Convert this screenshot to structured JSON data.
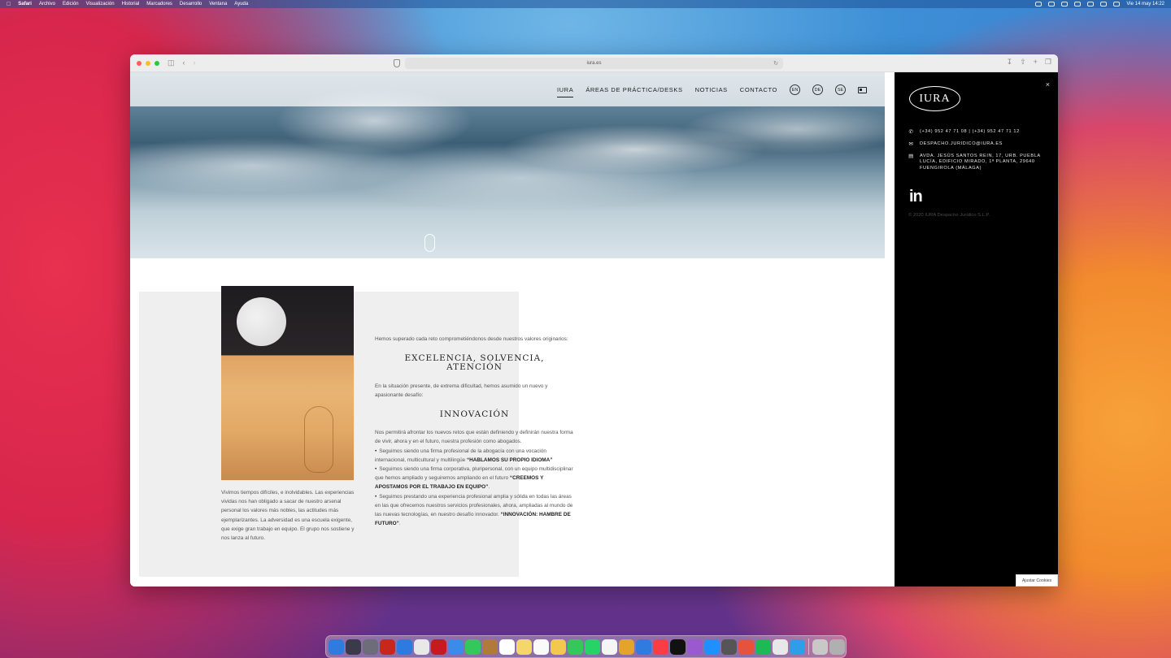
{
  "menubar": {
    "app": "Safari",
    "items": [
      "Archivo",
      "Edición",
      "Visualización",
      "Historial",
      "Marcadores",
      "Desarrollo",
      "Ventana",
      "Ayuda"
    ],
    "clock": "Vie 14 may  14:22"
  },
  "browser": {
    "url": "iura.es"
  },
  "site": {
    "nav": [
      "IURA",
      "ÁREAS DE PRÁCTICA/DESKS",
      "NOTICIAS",
      "CONTACTO"
    ],
    "languages": [
      "EN",
      "DE",
      "SE"
    ]
  },
  "content": {
    "left_text": "Vivimos tiempos difíciles, e inolvidables. Las experiencias vividas nos han obligado a sacar de nuestro arsenal personal los valores más nobles, las actitudes más ejemplarizantes. La adversidad es una escuela exigente, que exige gran trabajo en equipo. El grupo nos sostiene y nos lanza al futuro.",
    "intro": "Hemos superado cada reto comprometiéndonos desde nuestros valores originarios:",
    "heading1": "EXCELENCIA, SOLVENCIA, ATENCIÓN",
    "para2": "En la situación presente, de extrema dificultad, hemos asumido un nuevo y apasionante desafío:",
    "heading2": "INNOVACIÓN",
    "para3": "Nos permitirá afrontar los nuevos retos que están definiendo y definirán nuestra forma de vivir, ahora y en el futuro, nuestra profesión como abogados.",
    "bullet1": "Seguimos siendo una firma profesional de la abogacía con una vocación internacional, multicultural y multilingüe ",
    "bullet1_strong": "“HABLAMOS SU PROPIO IDIOMA”",
    "bullet2": "Seguimos siendo una firma corporativa, pluripersonal, con un equipo multidisciplinar que hemos ampliado y seguiremos ampliando en el futuro ",
    "bullet2_strong": "“CREEMOS Y APOSTAMOS POR EL TRABAJO EN EQUIPO”",
    "bullet2_end": ".",
    "bullet3": "Seguimos prestando una experiencia profesional amplia y sólida en todas las áreas en las que ofrecemos nuestros servicios profesionales, ahora, ampliadas al mundo de las nuevas tecnologías, en nuestro desafío innovador. ",
    "bullet3_strong": "“INNOVACIÓN: HAMBRE DE FUTURO”",
    "bullet3_end": "."
  },
  "sidebar": {
    "logo": "IURA",
    "close_icon": "×",
    "phone": "(+34) 952 47 71 08 | (+34) 952 47 71 12",
    "email": "DESPACHO.JURIDICO@IURA.ES",
    "address": "AVDA. JESÚS SANTOS REIN, 17, URB. PUEBLA LUCÍA, EDIFICIO MIRADO, 1ª PLANTA, 29640 FUENGIROLA (MÁLAGA)",
    "linkedin": "in",
    "copyright": "© 2020 IURA Despacho Jurídico S.L.P."
  },
  "cookies_button": "Ajustar Cookies",
  "colors": {
    "sidebar_bg": "#000000",
    "grey_box": "#efefef",
    "text": "#555555"
  },
  "dock": {
    "icon_colors": [
      "#2f7be0",
      "#3a3a4a",
      "#6d6d7a",
      "#c8281c",
      "#2d7be0",
      "#e8e8e8",
      "#c71a1f",
      "#3b8be8",
      "#34c759",
      "#b07a3a",
      "#ffffff",
      "#f5d66b",
      "#fafafa",
      "#f2c94c",
      "#34c759",
      "#25d366",
      "#f5f5f5",
      "#e4a32b",
      "#2f7be0",
      "#fc3c44",
      "#111111",
      "#9b59d0",
      "#1e90ff",
      "#555555",
      "#e5533d",
      "#1db954",
      "#e8e8e8",
      "#2f9ee8",
      "#c8c8c8",
      "#b0b0b0"
    ]
  }
}
